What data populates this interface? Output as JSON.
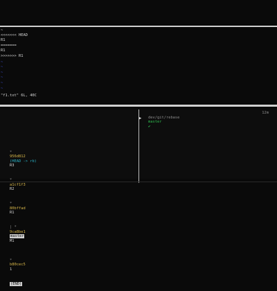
{
  "editor": {
    "lines": [
      "<<<<<<< HEAD",
      "R1",
      "=======",
      "R1",
      ">>>>>>> R1"
    ],
    "tilde": "~",
    "status": "\"f1.txt\" 6L, 40C"
  },
  "prompt": {
    "path": "dev/git/rebase",
    "branch": "master",
    "check": "✔",
    "cursor": "▶",
    "time": "12m"
  },
  "log": {
    "entries": [
      {
        "bullet": "*",
        "hash": "956d812",
        "refs": "(HEAD -> rb)",
        "msg": "R3"
      },
      {
        "bullet": "*",
        "hash": "a1cf1f3",
        "refs": "",
        "msg": "R2"
      },
      {
        "bullet": "*",
        "hash": "80bffad",
        "refs": "",
        "msg": "R1"
      },
      {
        "bullet": "| *",
        "hash": "9ca8be1",
        "refs": "master",
        "msg": "M1"
      },
      {
        "bullet": "*",
        "hash": "b80cec5",
        "refs": "",
        "msg": "1"
      }
    ],
    "end_marker": "(END)"
  }
}
